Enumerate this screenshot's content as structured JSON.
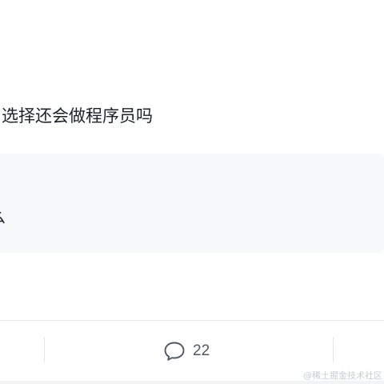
{
  "post": {
    "title": "选择还会做程序员吗"
  },
  "quote": {
    "text": "么"
  },
  "actions": {
    "comment_count": "22"
  },
  "watermark": {
    "text": "@稀土掘金技术社区"
  },
  "icons": {
    "comment": "comment-bubble-icon"
  }
}
